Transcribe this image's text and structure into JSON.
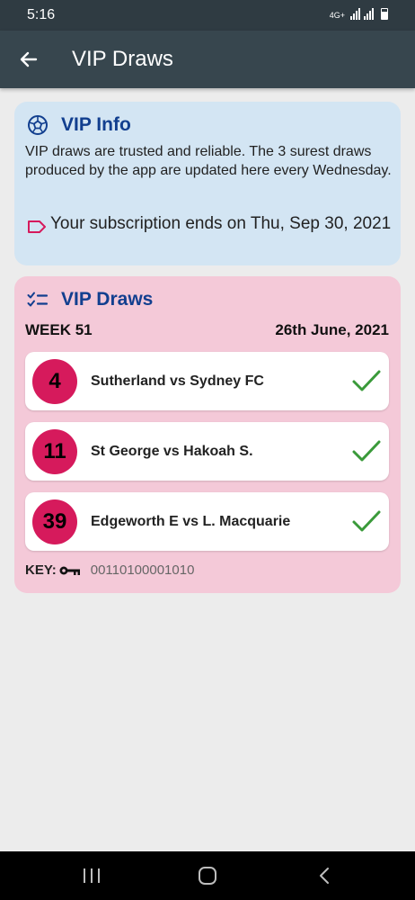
{
  "status_bar": {
    "time": "5:16",
    "network": "4G+"
  },
  "app_bar": {
    "title": "VIP Draws"
  },
  "info_card": {
    "title": "VIP Info",
    "text": "VIP draws are trusted and reliable. The 3 surest draws produced by the app are updated here every Wednesday.",
    "subscription": "Your subscription ends on Thu, Sep 30, 2021"
  },
  "draws_card": {
    "title": "VIP Draws",
    "week": "WEEK 51",
    "date": "26th June, 2021",
    "matches": [
      {
        "number": "4",
        "name": "Sutherland vs Sydney FC"
      },
      {
        "number": "11",
        "name": "St George vs Hakoah S."
      },
      {
        "number": "39",
        "name": "Edgeworth E vs L. Macquarie"
      }
    ],
    "key_label": "KEY:",
    "key_value": "00110100001010"
  },
  "colors": {
    "accent_blue": "#123f8f",
    "badge_pink": "#d61a5c",
    "check_green": "#3a9a3a",
    "info_bg": "#d3e5f3",
    "draws_bg": "#f4c9d8"
  }
}
